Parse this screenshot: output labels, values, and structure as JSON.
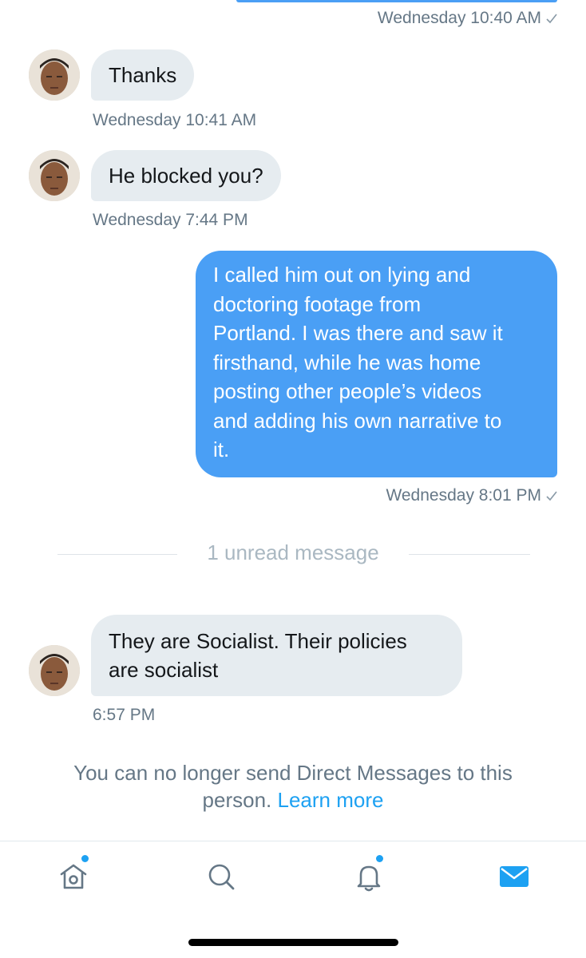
{
  "messages": [
    {
      "direction": "out",
      "timestamp": "Wednesday 10:40 AM",
      "read_check": true
    },
    {
      "direction": "in",
      "text": "Thanks",
      "timestamp": "Wednesday 10:41 AM"
    },
    {
      "direction": "in",
      "text": "He blocked you?",
      "timestamp": "Wednesday 7:44 PM"
    },
    {
      "direction": "out",
      "lines": [
        "I called him out on lying and",
        "doctoring footage from",
        "Portland. I was there and saw it",
        "firsthand, while he was home",
        "posting other people’s videos",
        "and adding his own narrative to",
        "it."
      ],
      "timestamp": "Wednesday 8:01 PM",
      "read_check": true
    },
    {
      "direction": "in",
      "lines": [
        "They are Socialist. Their policies",
        "are socialist"
      ],
      "timestamp": "6:57 PM"
    }
  ],
  "unread_divider": "1 unread message",
  "notice": {
    "line1": "You can no longer send Direct Messages to this",
    "line2_prefix": "person.",
    "link": "Learn more"
  },
  "tabbar": {
    "tabs": [
      "home-icon",
      "search-icon",
      "notifications-icon",
      "messages-icon"
    ],
    "active": "messages-icon"
  },
  "colors": {
    "accent": "#1da1f2",
    "outgoing_bubble": "#4a9ff5",
    "incoming_bubble": "#e6ecf0",
    "secondary_text": "#657786"
  }
}
